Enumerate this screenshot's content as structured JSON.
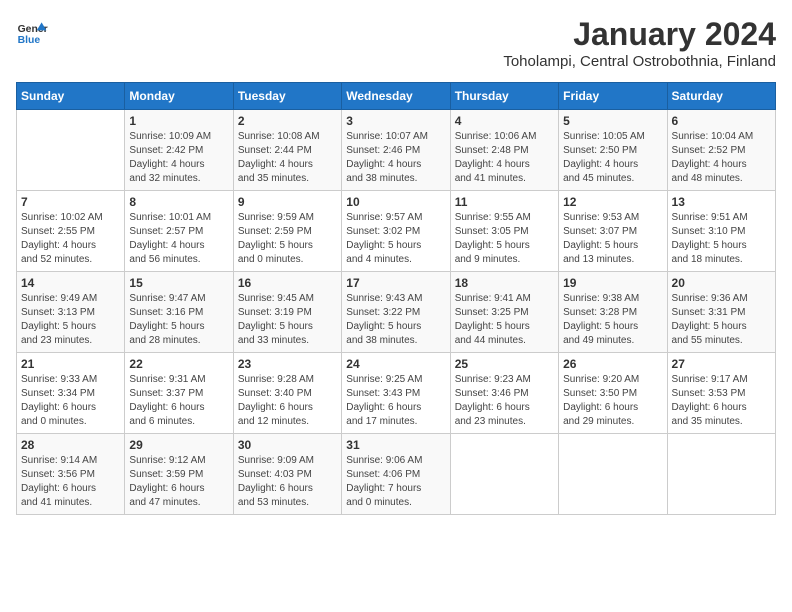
{
  "header": {
    "logo_line1": "General",
    "logo_line2": "Blue",
    "title": "January 2024",
    "subtitle": "Toholampi, Central Ostrobothnia, Finland"
  },
  "weekdays": [
    "Sunday",
    "Monday",
    "Tuesday",
    "Wednesday",
    "Thursday",
    "Friday",
    "Saturday"
  ],
  "weeks": [
    [
      {
        "day": "",
        "info": ""
      },
      {
        "day": "1",
        "info": "Sunrise: 10:09 AM\nSunset: 2:42 PM\nDaylight: 4 hours\nand 32 minutes."
      },
      {
        "day": "2",
        "info": "Sunrise: 10:08 AM\nSunset: 2:44 PM\nDaylight: 4 hours\nand 35 minutes."
      },
      {
        "day": "3",
        "info": "Sunrise: 10:07 AM\nSunset: 2:46 PM\nDaylight: 4 hours\nand 38 minutes."
      },
      {
        "day": "4",
        "info": "Sunrise: 10:06 AM\nSunset: 2:48 PM\nDaylight: 4 hours\nand 41 minutes."
      },
      {
        "day": "5",
        "info": "Sunrise: 10:05 AM\nSunset: 2:50 PM\nDaylight: 4 hours\nand 45 minutes."
      },
      {
        "day": "6",
        "info": "Sunrise: 10:04 AM\nSunset: 2:52 PM\nDaylight: 4 hours\nand 48 minutes."
      }
    ],
    [
      {
        "day": "7",
        "info": "Sunrise: 10:02 AM\nSunset: 2:55 PM\nDaylight: 4 hours\nand 52 minutes."
      },
      {
        "day": "8",
        "info": "Sunrise: 10:01 AM\nSunset: 2:57 PM\nDaylight: 4 hours\nand 56 minutes."
      },
      {
        "day": "9",
        "info": "Sunrise: 9:59 AM\nSunset: 2:59 PM\nDaylight: 5 hours\nand 0 minutes."
      },
      {
        "day": "10",
        "info": "Sunrise: 9:57 AM\nSunset: 3:02 PM\nDaylight: 5 hours\nand 4 minutes."
      },
      {
        "day": "11",
        "info": "Sunrise: 9:55 AM\nSunset: 3:05 PM\nDaylight: 5 hours\nand 9 minutes."
      },
      {
        "day": "12",
        "info": "Sunrise: 9:53 AM\nSunset: 3:07 PM\nDaylight: 5 hours\nand 13 minutes."
      },
      {
        "day": "13",
        "info": "Sunrise: 9:51 AM\nSunset: 3:10 PM\nDaylight: 5 hours\nand 18 minutes."
      }
    ],
    [
      {
        "day": "14",
        "info": "Sunrise: 9:49 AM\nSunset: 3:13 PM\nDaylight: 5 hours\nand 23 minutes."
      },
      {
        "day": "15",
        "info": "Sunrise: 9:47 AM\nSunset: 3:16 PM\nDaylight: 5 hours\nand 28 minutes."
      },
      {
        "day": "16",
        "info": "Sunrise: 9:45 AM\nSunset: 3:19 PM\nDaylight: 5 hours\nand 33 minutes."
      },
      {
        "day": "17",
        "info": "Sunrise: 9:43 AM\nSunset: 3:22 PM\nDaylight: 5 hours\nand 38 minutes."
      },
      {
        "day": "18",
        "info": "Sunrise: 9:41 AM\nSunset: 3:25 PM\nDaylight: 5 hours\nand 44 minutes."
      },
      {
        "day": "19",
        "info": "Sunrise: 9:38 AM\nSunset: 3:28 PM\nDaylight: 5 hours\nand 49 minutes."
      },
      {
        "day": "20",
        "info": "Sunrise: 9:36 AM\nSunset: 3:31 PM\nDaylight: 5 hours\nand 55 minutes."
      }
    ],
    [
      {
        "day": "21",
        "info": "Sunrise: 9:33 AM\nSunset: 3:34 PM\nDaylight: 6 hours\nand 0 minutes."
      },
      {
        "day": "22",
        "info": "Sunrise: 9:31 AM\nSunset: 3:37 PM\nDaylight: 6 hours\nand 6 minutes."
      },
      {
        "day": "23",
        "info": "Sunrise: 9:28 AM\nSunset: 3:40 PM\nDaylight: 6 hours\nand 12 minutes."
      },
      {
        "day": "24",
        "info": "Sunrise: 9:25 AM\nSunset: 3:43 PM\nDaylight: 6 hours\nand 17 minutes."
      },
      {
        "day": "25",
        "info": "Sunrise: 9:23 AM\nSunset: 3:46 PM\nDaylight: 6 hours\nand 23 minutes."
      },
      {
        "day": "26",
        "info": "Sunrise: 9:20 AM\nSunset: 3:50 PM\nDaylight: 6 hours\nand 29 minutes."
      },
      {
        "day": "27",
        "info": "Sunrise: 9:17 AM\nSunset: 3:53 PM\nDaylight: 6 hours\nand 35 minutes."
      }
    ],
    [
      {
        "day": "28",
        "info": "Sunrise: 9:14 AM\nSunset: 3:56 PM\nDaylight: 6 hours\nand 41 minutes."
      },
      {
        "day": "29",
        "info": "Sunrise: 9:12 AM\nSunset: 3:59 PM\nDaylight: 6 hours\nand 47 minutes."
      },
      {
        "day": "30",
        "info": "Sunrise: 9:09 AM\nSunset: 4:03 PM\nDaylight: 6 hours\nand 53 minutes."
      },
      {
        "day": "31",
        "info": "Sunrise: 9:06 AM\nSunset: 4:06 PM\nDaylight: 7 hours\nand 0 minutes."
      },
      {
        "day": "",
        "info": ""
      },
      {
        "day": "",
        "info": ""
      },
      {
        "day": "",
        "info": ""
      }
    ]
  ]
}
